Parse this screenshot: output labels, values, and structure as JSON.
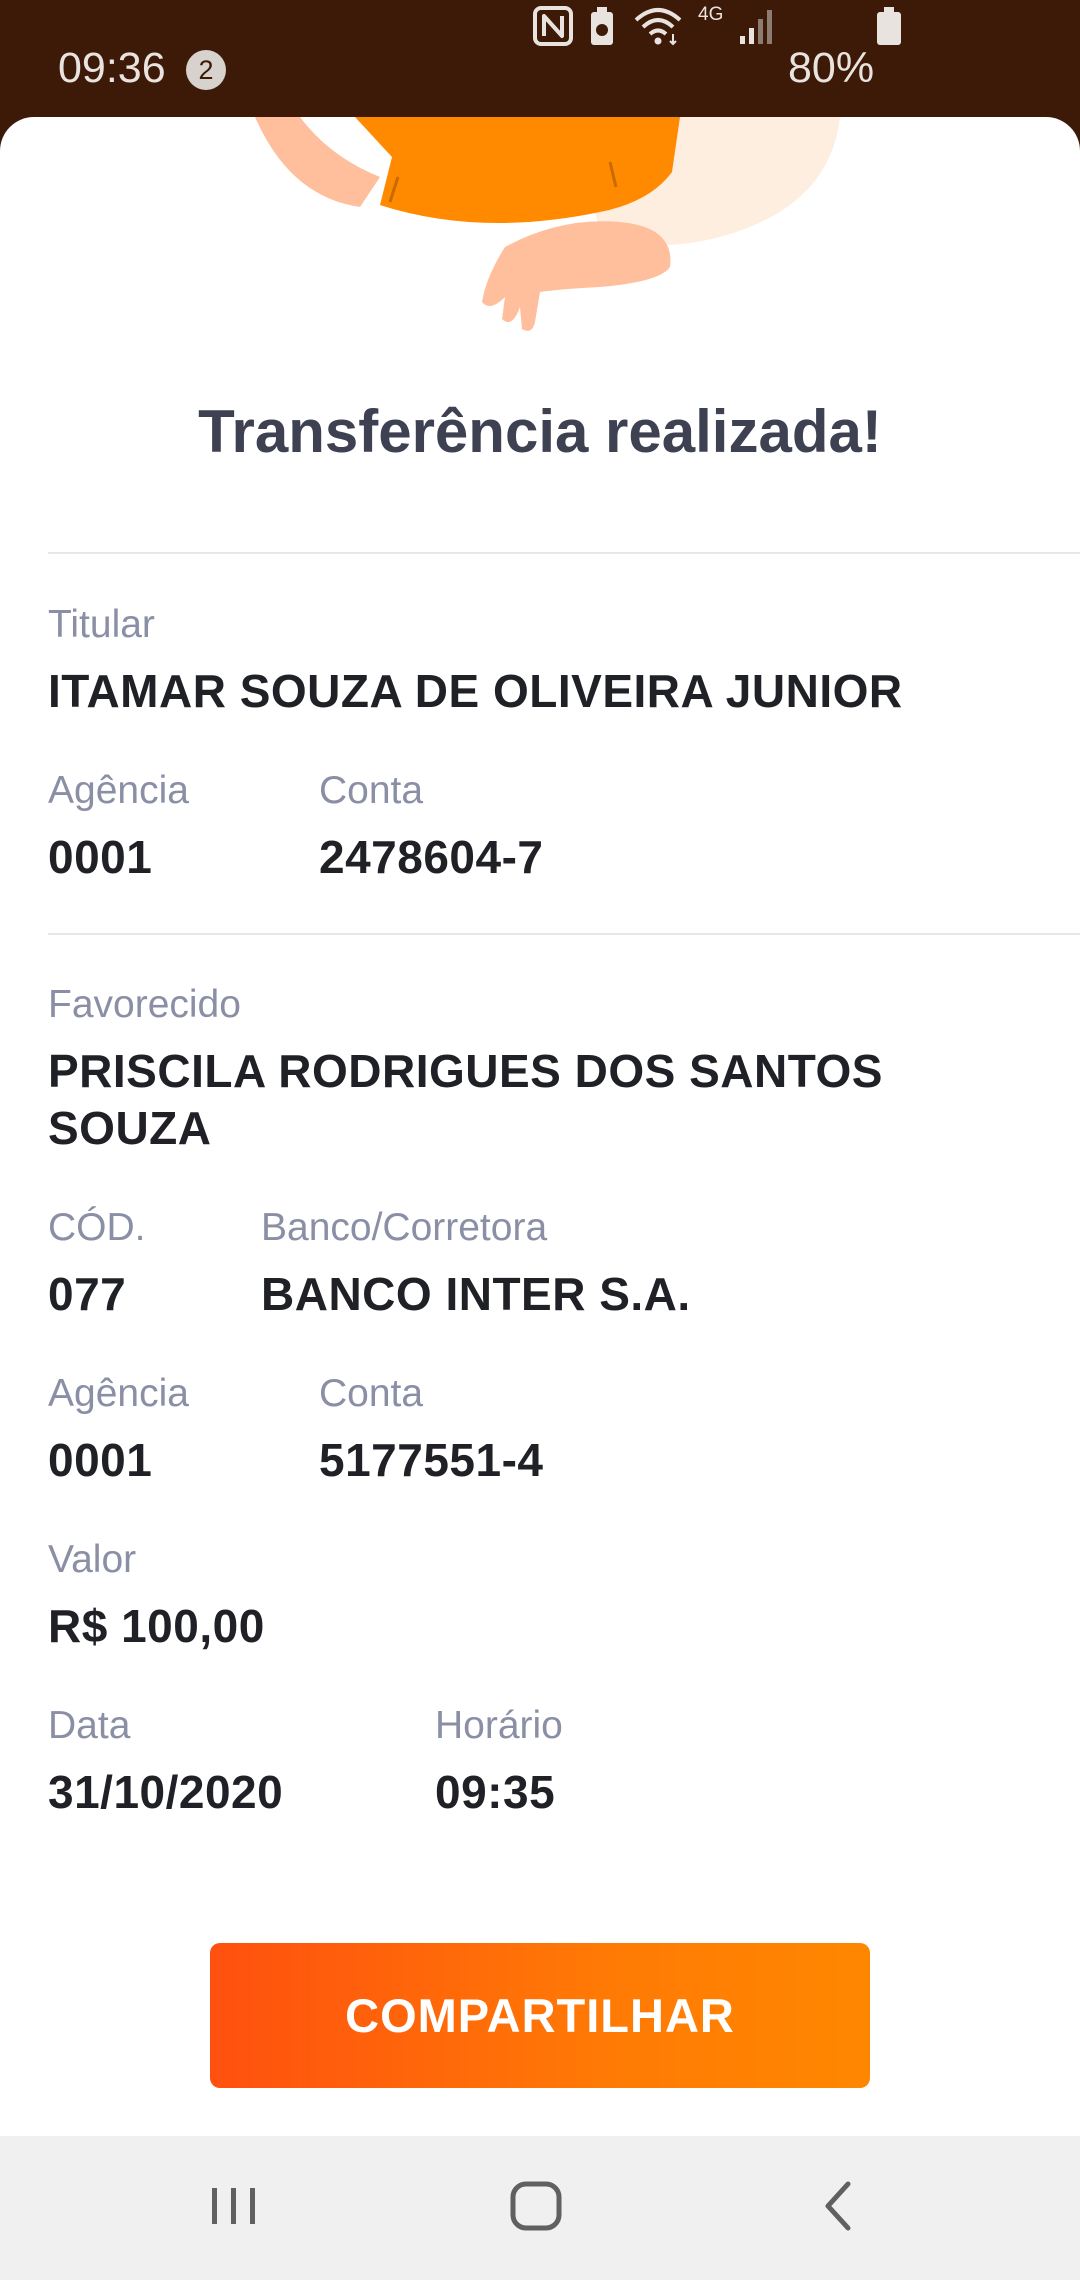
{
  "status_bar": {
    "time": "09:36",
    "notification_count": "2",
    "network": "4G",
    "battery": "80%",
    "icons": [
      "nfc-icon",
      "battery-saver-icon",
      "wifi-icon",
      "signal-icon",
      "battery-icon"
    ]
  },
  "receipt": {
    "title": "Transferência realizada!",
    "sender": {
      "holder_label": "Titular",
      "holder": "ITAMAR SOUZA DE OLIVEIRA JUNIOR",
      "agency_label": "Agência",
      "agency": "0001",
      "account_label": "Conta",
      "account": "2478604-7"
    },
    "recipient": {
      "label": "Favorecido",
      "name_line1": "PRISCILA RODRIGUES DOS SANTOS",
      "name_line2": "SOUZA",
      "code_label": "CÓD.",
      "code": "077",
      "bank_label": "Banco/Corretora",
      "bank": "BANCO INTER S.A.",
      "agency_label": "Agência",
      "agency": "0001",
      "account_label": "Conta",
      "account": "5177551-4"
    },
    "amount_label": "Valor",
    "amount": "R$ 100,00",
    "date_label": "Data",
    "date": "31/10/2020",
    "time_label": "Horário",
    "time": "09:35"
  },
  "actions": {
    "share_label": "COMPARTILHAR"
  },
  "colors": {
    "status_bar_bg": "#3d1a08",
    "accent_start": "#ff500f",
    "accent_end": "#ff8700",
    "label": "#8a8fa6",
    "value": "#1f2127"
  },
  "nav_bar": {
    "icons": [
      "recent-apps-icon",
      "home-icon",
      "back-icon"
    ]
  }
}
